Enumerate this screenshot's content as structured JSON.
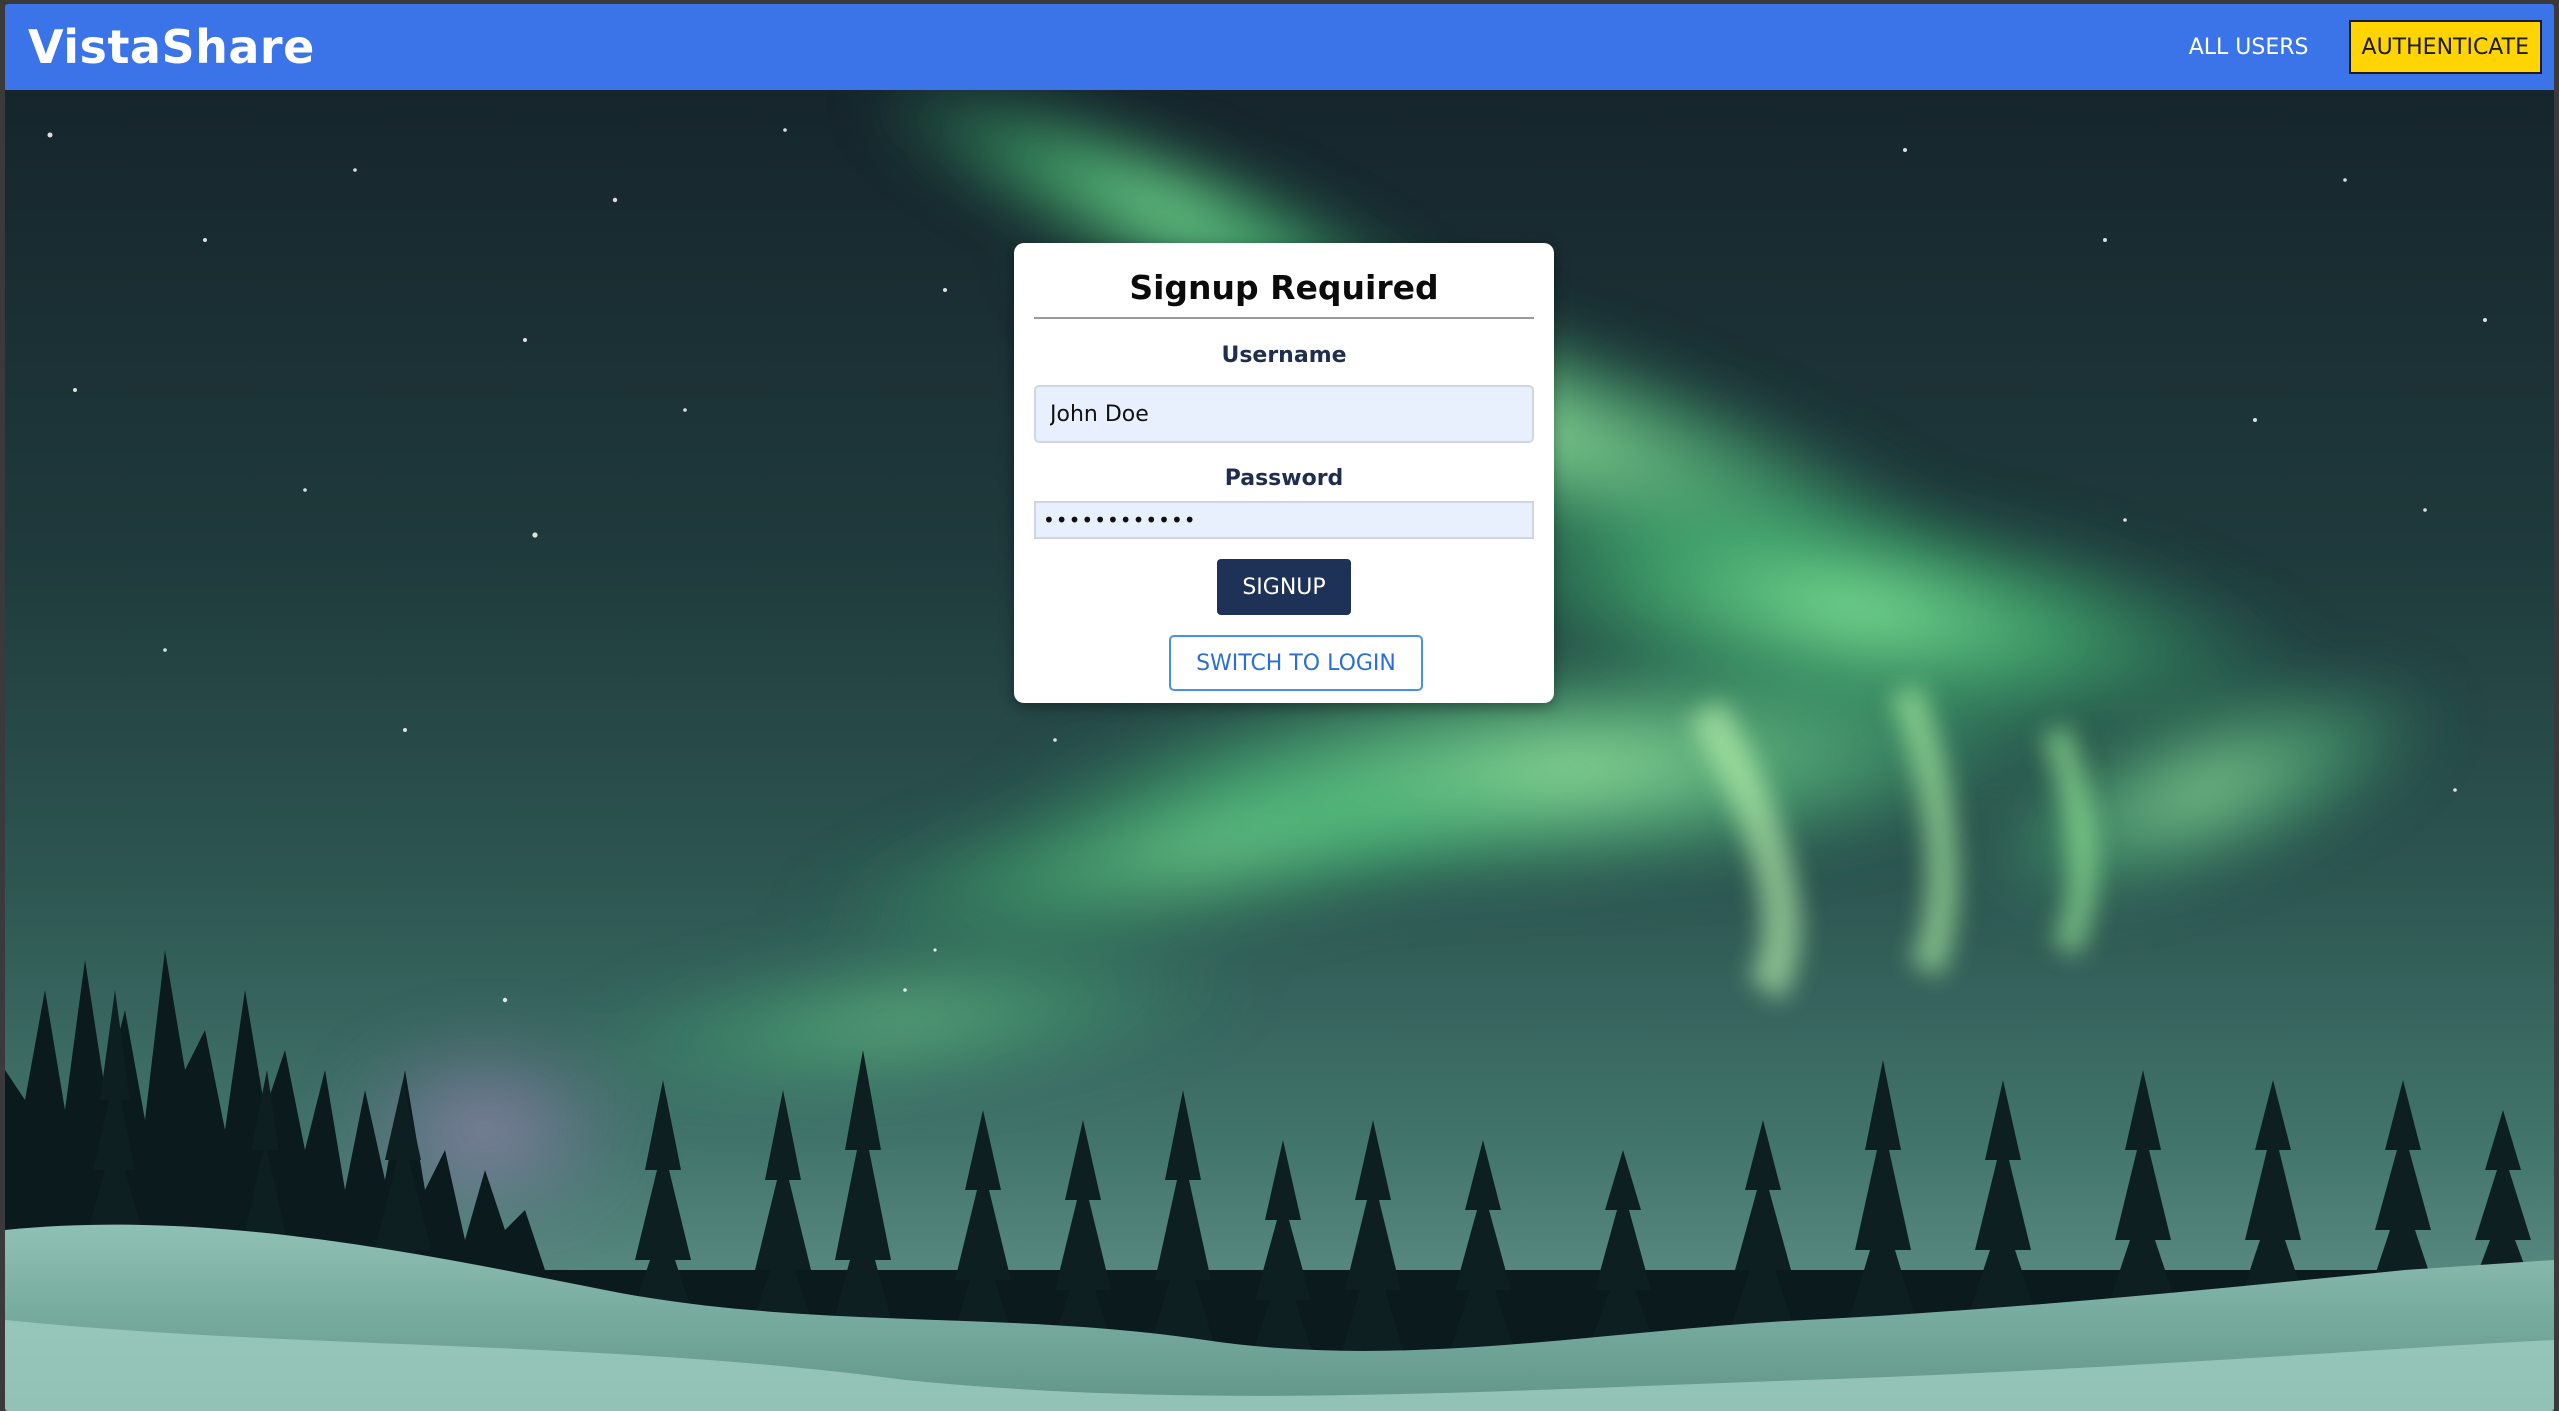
{
  "header": {
    "logo": "VistaShare",
    "nav": {
      "all_users": "ALL USERS",
      "authenticate": "AUTHENTICATE"
    }
  },
  "colors": {
    "header_bg": "#3b74e8",
    "auth_button_bg": "#ffd400",
    "primary_button_bg": "#1e3258",
    "secondary_button_text": "#2a6fd6"
  },
  "signup_form": {
    "title": "Signup Required",
    "username_label": "Username",
    "username_value": "John Doe",
    "password_label": "Password",
    "password_value": "••••••••••••",
    "submit_label": "SIGNUP",
    "switch_label": "SWITCH TO LOGIN"
  },
  "background": {
    "icon": "aurora-landscape-image"
  }
}
